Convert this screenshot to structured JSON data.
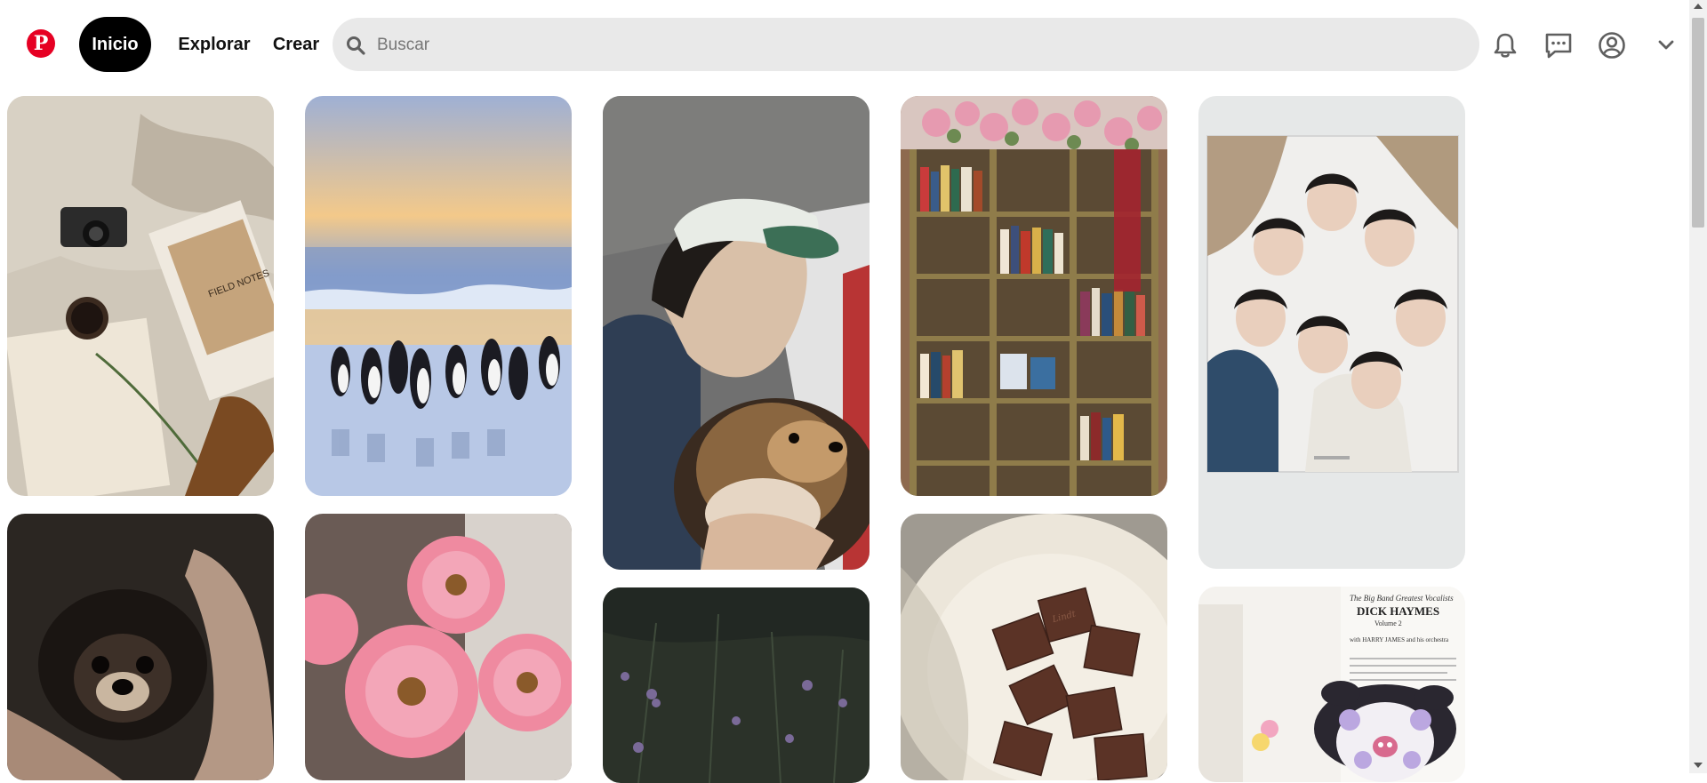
{
  "header": {
    "logo_label": "P",
    "nav": {
      "inicio": "Inicio",
      "explorar": "Explorar",
      "crear": "Crear"
    },
    "search": {
      "placeholder": "Buscar",
      "value": ""
    },
    "icons": [
      "pinterest-logo-icon",
      "search-icon",
      "bell-icon",
      "message-icon",
      "profile-icon",
      "chevron-down-icon"
    ]
  },
  "pins": [
    {
      "id": "cozy-books-camera",
      "alt": "Cámara, libros y café sobre una manta"
    },
    {
      "id": "penguins-beach",
      "alt": "Pingüinos en la playa al atardecer"
    },
    {
      "id": "boy-with-dog",
      "alt": "Chico con gorra sosteniendo un perro"
    },
    {
      "id": "bookshop-flowers",
      "alt": "Librería con flores"
    },
    {
      "id": "group-circle",
      "alt": "Grupo mirando hacia abajo en círculo"
    },
    {
      "id": "small-dog-hands",
      "alt": "Perro pequeño entre manos"
    },
    {
      "id": "pink-gerberas",
      "alt": "Gerberas rosadas"
    },
    {
      "id": "dark-flowers",
      "alt": "Flores silvestres oscuras"
    },
    {
      "id": "chocolates-plate",
      "alt": "Chocolates en plato blanco"
    },
    {
      "id": "record-kuromi",
      "alt": "Disco Dick Haymes y peluche Kuromi"
    }
  ],
  "pin_text": {
    "field_notes": "FIELD NOTES",
    "record_title": "DICK HAYMES",
    "record_subtitle": "The Big Band Greatest Vocalists",
    "record_volume": "Volume 2",
    "record_with": "with HARRY JAMES and his orchestra",
    "chocolate_brand": "Lindt"
  },
  "colors": {
    "brand": "#e60023",
    "active_pill": "#000000",
    "search_bg": "#e9e9e9"
  }
}
